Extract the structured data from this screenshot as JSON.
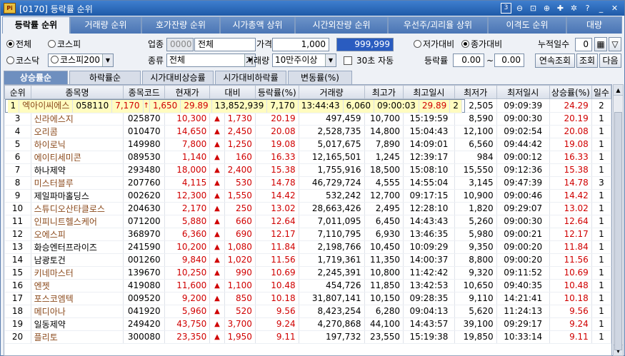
{
  "window": {
    "code": "[0170]",
    "title": "등락률 순위"
  },
  "title_icons": [
    "3",
    "zoom-out-icon",
    "fit-icon",
    "zoom-in-icon",
    "pin-icon",
    "settings-icon",
    "help-icon",
    "minimize-icon",
    "close-icon"
  ],
  "tabs": [
    "등락률 순위",
    "거래량 순위",
    "호가잔량 순위",
    "시가총액 상위",
    "시간외잔량 순위",
    "우선주/괴리율 상위",
    "이격도 순위",
    "대량"
  ],
  "filters": {
    "market_all": "전체",
    "market_kospi": "코스피",
    "market_kosdaq": "코스닥",
    "kospi200": "코스피200",
    "sector_label": "업종",
    "sector_code": "0000",
    "sector_name": "전체",
    "kind_label": "종류",
    "kind_value": "전체",
    "price_label": "가격",
    "price_from": "1,000",
    "price_to": "999,999",
    "volume_label": "거래량",
    "volume_value": "10만주이상",
    "auto_label": "30초 자동",
    "basis_low": "저가대비",
    "basis_close": "종가대비",
    "rate_label": "등락률",
    "rate_from": "0.00",
    "rate_sep": "~",
    "rate_to": "0.00",
    "days_label": "누적일수",
    "days_value": "0",
    "btn_continuous": "연속조회",
    "btn_search": "조회",
    "btn_next": "다음"
  },
  "subtabs": [
    "상승률순",
    "하락률순",
    "시가대비상승률",
    "시가대비하락률",
    "변동률(%)"
  ],
  "columns": [
    "순위",
    "종목명",
    "종목코드",
    "현재가",
    "대비",
    "등락률(%)",
    "거래량",
    "최고가",
    "최고일시",
    "최저가",
    "최저일시",
    "상승률(%)",
    "일수"
  ],
  "rows": [
    [
      "1",
      "엑아이씨에스",
      "058110",
      "7,170",
      "↑",
      "1,650",
      "29.89",
      "13,852,939",
      "7,170",
      "13:44:43",
      "6,060",
      "09:00:03",
      "29.89",
      "2"
    ],
    [
      "2",
      "코이즈",
      "121850",
      "3,300",
      "▲",
      "645",
      "24.29",
      "36,417,654",
      "3,450",
      "14:22:46",
      "2,505",
      "09:09:39",
      "24.29",
      "2"
    ],
    [
      "3",
      "신라에스지",
      "025870",
      "10,300",
      "▲",
      "1,730",
      "20.19",
      "497,459",
      "10,700",
      "15:19:59",
      "8,590",
      "09:00:30",
      "20.19",
      "1"
    ],
    [
      "4",
      "오리콤",
      "010470",
      "14,650",
      "▲",
      "2,450",
      "20.08",
      "2,528,735",
      "14,800",
      "15:04:43",
      "12,100",
      "09:02:54",
      "20.08",
      "1"
    ],
    [
      "5",
      "하이로닉",
      "149980",
      "7,800",
      "▲",
      "1,250",
      "19.08",
      "5,017,675",
      "7,890",
      "14:09:01",
      "6,560",
      "09:44:42",
      "19.08",
      "1"
    ],
    [
      "6",
      "에이티세미콘",
      "089530",
      "1,140",
      "▲",
      "160",
      "16.33",
      "12,165,501",
      "1,245",
      "12:39:17",
      "984",
      "09:00:12",
      "16.33",
      "1"
    ],
    [
      "7",
      "하나제약",
      "293480",
      "18,000",
      "▲",
      "2,400",
      "15.38",
      "1,755,916",
      "18,500",
      "15:08:10",
      "15,550",
      "09:12:36",
      "15.38",
      "1"
    ],
    [
      "8",
      "미스터블루",
      "207760",
      "4,115",
      "▲",
      "530",
      "14.78",
      "46,729,724",
      "4,555",
      "14:55:04",
      "3,145",
      "09:47:39",
      "14.78",
      "3"
    ],
    [
      "9",
      "제일파마홀딩스",
      "002620",
      "12,300",
      "▲",
      "1,550",
      "14.42",
      "532,242",
      "12,700",
      "09:17:15",
      "10,900",
      "09:00:46",
      "14.42",
      "1"
    ],
    [
      "10",
      "스튜디오산타클로스",
      "204630",
      "2,170",
      "▲",
      "250",
      "13.02",
      "28,663,426",
      "2,495",
      "12:28:10",
      "1,820",
      "09:29:07",
      "13.02",
      "1"
    ],
    [
      "11",
      "인피니트헬스케어",
      "071200",
      "5,880",
      "▲",
      "660",
      "12.64",
      "7,011,095",
      "6,450",
      "14:43:43",
      "5,260",
      "09:00:30",
      "12.64",
      "1"
    ],
    [
      "12",
      "오에스피",
      "368970",
      "6,360",
      "▲",
      "690",
      "12.17",
      "7,110,795",
      "6,930",
      "13:46:35",
      "5,980",
      "09:00:21",
      "12.17",
      "1"
    ],
    [
      "13",
      "화승엔터프라이즈",
      "241590",
      "10,200",
      "▲",
      "1,080",
      "11.84",
      "2,198,766",
      "10,450",
      "10:09:29",
      "9,350",
      "09:00:20",
      "11.84",
      "1"
    ],
    [
      "14",
      "남광토건",
      "001260",
      "9,840",
      "▲",
      "1,020",
      "11.56",
      "1,719,361",
      "11,350",
      "14:00:37",
      "8,800",
      "09:00:20",
      "11.56",
      "1"
    ],
    [
      "15",
      "키네마스터",
      "139670",
      "10,250",
      "▲",
      "990",
      "10.69",
      "2,245,391",
      "10,800",
      "11:42:42",
      "9,320",
      "09:11:52",
      "10.69",
      "1"
    ],
    [
      "16",
      "엔젯",
      "419080",
      "11,600",
      "▲",
      "1,100",
      "10.48",
      "454,726",
      "11,850",
      "13:42:53",
      "10,650",
      "09:40:35",
      "10.48",
      "1"
    ],
    [
      "17",
      "포스코엠텍",
      "009520",
      "9,200",
      "▲",
      "850",
      "10.18",
      "31,807,141",
      "10,150",
      "09:28:35",
      "9,110",
      "14:21:41",
      "10.18",
      "1"
    ],
    [
      "18",
      "메디아나",
      "041920",
      "5,960",
      "▲",
      "520",
      "9.56",
      "8,423,254",
      "6,280",
      "09:04:13",
      "5,620",
      "11:24:13",
      "9.56",
      "1"
    ],
    [
      "19",
      "일동제약",
      "249420",
      "43,750",
      "▲",
      "3,700",
      "9.24",
      "4,270,868",
      "44,100",
      "14:43:57",
      "39,100",
      "09:29:17",
      "9.24",
      "1"
    ],
    [
      "20",
      "플리토",
      "300080",
      "23,350",
      "▲",
      "1,950",
      "9.11",
      "197,732",
      "23,550",
      "15:19:38",
      "19,850",
      "10:33:14",
      "9.11",
      "1"
    ]
  ],
  "name_colors": {
    "kosdaq": "#8b4a1c",
    "kospi": "#000000"
  },
  "kospi_rows": [
    7,
    9,
    13,
    14,
    19
  ],
  "colors": {
    "up": "#d00000",
    "selected_row": "#fffcc0"
  }
}
